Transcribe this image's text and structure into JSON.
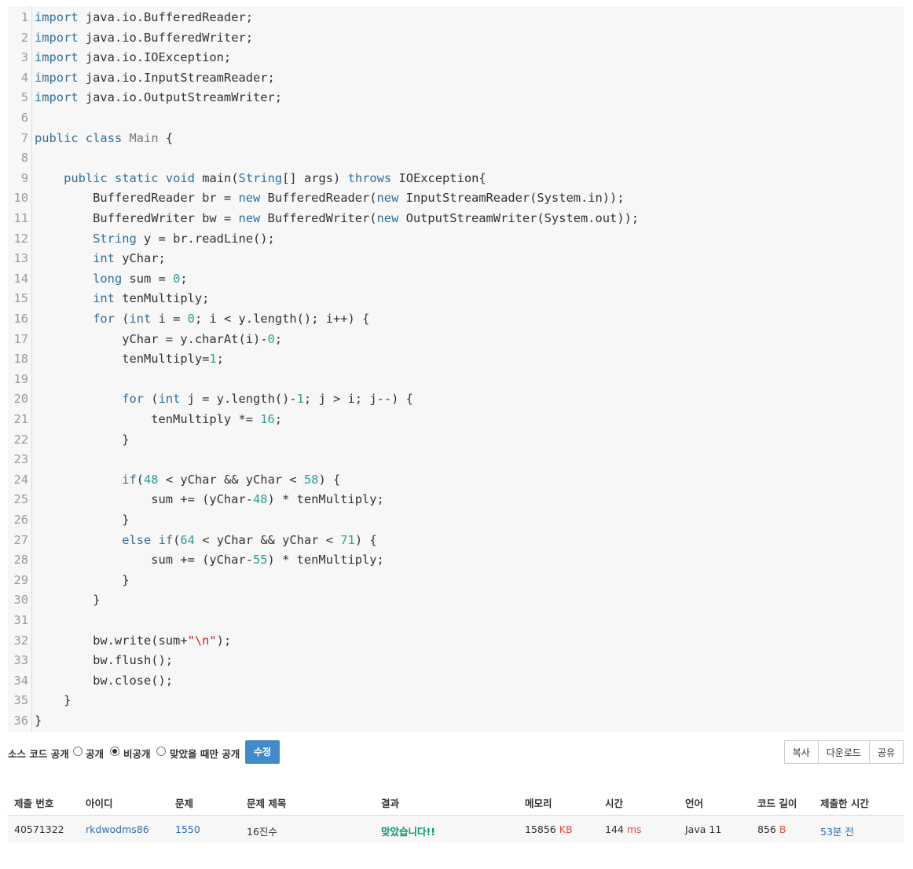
{
  "code": {
    "lines": [
      {
        "no": "1",
        "tokens": [
          {
            "t": "import",
            "c": "kw"
          },
          {
            "t": " java.io.BufferedReader;"
          }
        ]
      },
      {
        "no": "2",
        "tokens": [
          {
            "t": "import",
            "c": "kw"
          },
          {
            "t": " java.io.BufferedWriter;"
          }
        ]
      },
      {
        "no": "3",
        "tokens": [
          {
            "t": "import",
            "c": "kw"
          },
          {
            "t": " java.io.IOException;"
          }
        ]
      },
      {
        "no": "4",
        "tokens": [
          {
            "t": "import",
            "c": "kw"
          },
          {
            "t": " java.io.InputStreamReader;"
          }
        ]
      },
      {
        "no": "5",
        "tokens": [
          {
            "t": "import",
            "c": "kw"
          },
          {
            "t": " java.io.OutputStreamWriter;"
          }
        ]
      },
      {
        "no": "6",
        "tokens": []
      },
      {
        "no": "7",
        "tokens": [
          {
            "t": "public",
            "c": "kw"
          },
          {
            "t": " "
          },
          {
            "t": "class",
            "c": "kw"
          },
          {
            "t": " "
          },
          {
            "t": "Main",
            "c": "cls"
          },
          {
            "t": " {"
          }
        ]
      },
      {
        "no": "8",
        "tokens": []
      },
      {
        "no": "9",
        "tokens": [
          {
            "t": "    "
          },
          {
            "t": "public",
            "c": "kw"
          },
          {
            "t": " "
          },
          {
            "t": "static",
            "c": "kw"
          },
          {
            "t": " "
          },
          {
            "t": "void",
            "c": "kw"
          },
          {
            "t": " main("
          },
          {
            "t": "String",
            "c": "kw"
          },
          {
            "t": "[] args) "
          },
          {
            "t": "throws",
            "c": "kw"
          },
          {
            "t": " IOException{"
          }
        ]
      },
      {
        "no": "10",
        "tokens": [
          {
            "t": "        BufferedReader br = "
          },
          {
            "t": "new",
            "c": "kw"
          },
          {
            "t": " BufferedReader("
          },
          {
            "t": "new",
            "c": "kw"
          },
          {
            "t": " InputStreamReader(System.in));"
          }
        ]
      },
      {
        "no": "11",
        "tokens": [
          {
            "t": "        BufferedWriter bw = "
          },
          {
            "t": "new",
            "c": "kw"
          },
          {
            "t": " BufferedWriter("
          },
          {
            "t": "new",
            "c": "kw"
          },
          {
            "t": " OutputStreamWriter(System.out));"
          }
        ]
      },
      {
        "no": "12",
        "tokens": [
          {
            "t": "        "
          },
          {
            "t": "String",
            "c": "kw"
          },
          {
            "t": " y = br.readLine();"
          }
        ]
      },
      {
        "no": "13",
        "tokens": [
          {
            "t": "        "
          },
          {
            "t": "int",
            "c": "kw"
          },
          {
            "t": " yChar;"
          }
        ]
      },
      {
        "no": "14",
        "tokens": [
          {
            "t": "        "
          },
          {
            "t": "long",
            "c": "kw"
          },
          {
            "t": " sum = "
          },
          {
            "t": "0",
            "c": "num"
          },
          {
            "t": ";"
          }
        ]
      },
      {
        "no": "15",
        "tokens": [
          {
            "t": "        "
          },
          {
            "t": "int",
            "c": "kw"
          },
          {
            "t": " tenMultiply;"
          }
        ]
      },
      {
        "no": "16",
        "tokens": [
          {
            "t": "        "
          },
          {
            "t": "for",
            "c": "kw"
          },
          {
            "t": " ("
          },
          {
            "t": "int",
            "c": "kw"
          },
          {
            "t": " i = "
          },
          {
            "t": "0",
            "c": "num"
          },
          {
            "t": "; i < y.length(); i++) {"
          }
        ]
      },
      {
        "no": "17",
        "tokens": [
          {
            "t": "            yChar = y.charAt(i)-"
          },
          {
            "t": "0",
            "c": "num"
          },
          {
            "t": ";"
          }
        ]
      },
      {
        "no": "18",
        "tokens": [
          {
            "t": "            tenMultiply="
          },
          {
            "t": "1",
            "c": "num"
          },
          {
            "t": ";"
          }
        ]
      },
      {
        "no": "19",
        "tokens": []
      },
      {
        "no": "20",
        "tokens": [
          {
            "t": "            "
          },
          {
            "t": "for",
            "c": "kw"
          },
          {
            "t": " ("
          },
          {
            "t": "int",
            "c": "kw"
          },
          {
            "t": " j = y.length()-"
          },
          {
            "t": "1",
            "c": "num"
          },
          {
            "t": "; j > i; j--) {"
          }
        ]
      },
      {
        "no": "21",
        "tokens": [
          {
            "t": "                tenMultiply *= "
          },
          {
            "t": "16",
            "c": "num"
          },
          {
            "t": ";"
          }
        ]
      },
      {
        "no": "22",
        "tokens": [
          {
            "t": "            }"
          }
        ]
      },
      {
        "no": "23",
        "tokens": []
      },
      {
        "no": "24",
        "tokens": [
          {
            "t": "            "
          },
          {
            "t": "if",
            "c": "kw"
          },
          {
            "t": "("
          },
          {
            "t": "48",
            "c": "num"
          },
          {
            "t": " < yChar && yChar < "
          },
          {
            "t": "58",
            "c": "num"
          },
          {
            "t": ") {"
          }
        ]
      },
      {
        "no": "25",
        "tokens": [
          {
            "t": "                sum += (yChar-"
          },
          {
            "t": "48",
            "c": "num"
          },
          {
            "t": ") * tenMultiply;"
          }
        ]
      },
      {
        "no": "26",
        "tokens": [
          {
            "t": "            }"
          }
        ]
      },
      {
        "no": "27",
        "tokens": [
          {
            "t": "            "
          },
          {
            "t": "else",
            "c": "kw"
          },
          {
            "t": " "
          },
          {
            "t": "if",
            "c": "kw"
          },
          {
            "t": "("
          },
          {
            "t": "64",
            "c": "num"
          },
          {
            "t": " < yChar && yChar < "
          },
          {
            "t": "71",
            "c": "num"
          },
          {
            "t": ") {"
          }
        ]
      },
      {
        "no": "28",
        "tokens": [
          {
            "t": "                sum += (yChar-"
          },
          {
            "t": "55",
            "c": "num"
          },
          {
            "t": ") * tenMultiply;"
          }
        ]
      },
      {
        "no": "29",
        "tokens": [
          {
            "t": "            }"
          }
        ]
      },
      {
        "no": "30",
        "tokens": [
          {
            "t": "        }"
          }
        ]
      },
      {
        "no": "31",
        "tokens": []
      },
      {
        "no": "32",
        "tokens": [
          {
            "t": "        bw.write(sum+"
          },
          {
            "t": "\"\\n\"",
            "c": "str"
          },
          {
            "t": ");"
          }
        ]
      },
      {
        "no": "33",
        "tokens": [
          {
            "t": "        bw.flush();"
          }
        ]
      },
      {
        "no": "34",
        "tokens": [
          {
            "t": "        bw.close();"
          }
        ]
      },
      {
        "no": "35",
        "tokens": [
          {
            "t": "    }"
          }
        ]
      },
      {
        "no": "36",
        "tokens": [
          {
            "t": "}"
          }
        ]
      }
    ]
  },
  "visibility": {
    "label": "소스 코드 공개",
    "options": [
      {
        "label": "공개",
        "checked": false
      },
      {
        "label": "비공개",
        "checked": true
      },
      {
        "label": "맞았을 때만 공개",
        "checked": false
      }
    ],
    "save_button": "수정"
  },
  "actions": {
    "copy": "복사",
    "download": "다운로드",
    "share": "공유"
  },
  "table": {
    "headers": [
      "제출 번호",
      "아이디",
      "문제",
      "문제 제목",
      "결과",
      "메모리",
      "시간",
      "언어",
      "코드 길이",
      "제출한 시간"
    ],
    "row": {
      "submission_id": "40571322",
      "user_id": "rkdwodms86",
      "problem": "1550",
      "title": "16진수",
      "result": "맞았습니다!!",
      "memory": "15856",
      "memory_unit": "KB",
      "time": "144",
      "time_unit": "ms",
      "language": "Java 11",
      "code_length": "856",
      "code_length_unit": "B",
      "submitted": "53분 전"
    }
  }
}
